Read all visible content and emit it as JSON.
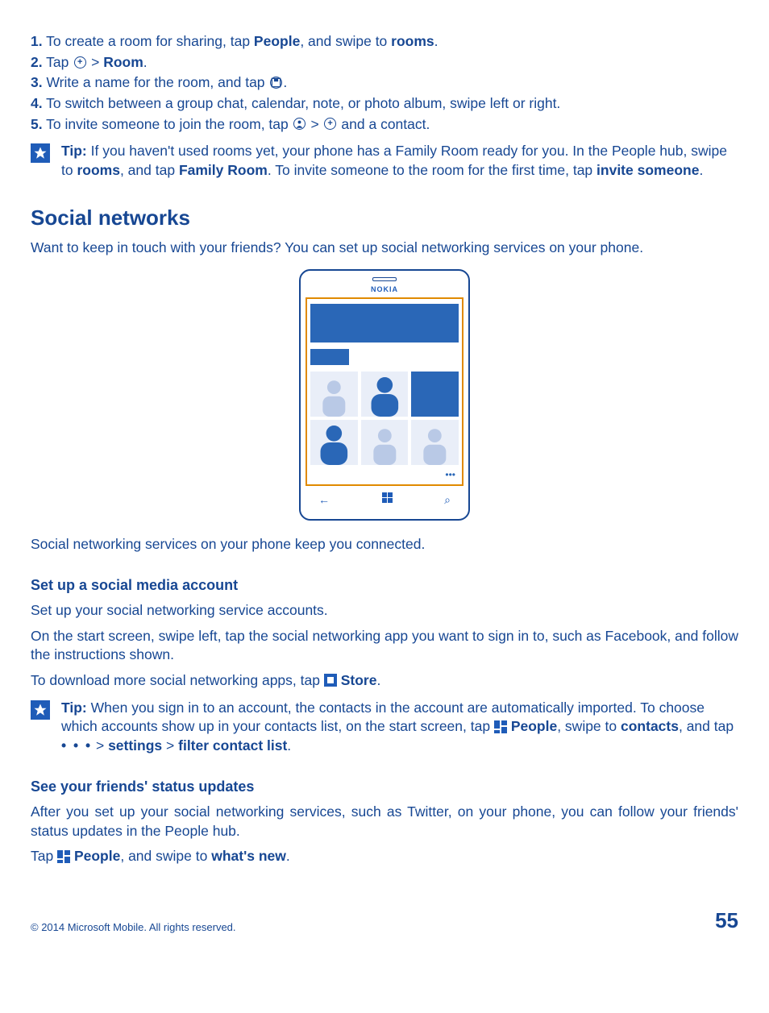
{
  "steps": [
    {
      "num": "1.",
      "pre": " To create a room for sharing, tap ",
      "b1": "People",
      "mid": ", and swipe to ",
      "b2": "rooms",
      "post": "."
    },
    {
      "num": "2.",
      "pre": " Tap ",
      "icon1": "plus",
      "mid": " > ",
      "b1": "Room",
      "post": "."
    },
    {
      "num": "3.",
      "pre": " Write a name for the room, and tap ",
      "icon1": "save",
      "post": "."
    },
    {
      "num": "4.",
      "pre": " To switch between a group chat, calendar, note, or photo album, swipe left or right."
    },
    {
      "num": "5.",
      "pre": " To invite someone to join the room, tap ",
      "icon1": "invite",
      "mid": " > ",
      "icon2": "plus",
      "post": " and a contact."
    }
  ],
  "tip1": {
    "label": "Tip:",
    "t1": " If you haven't used rooms yet, your phone has a Family Room ready for you. In the People hub, swipe to ",
    "b1": "rooms",
    "t2": ", and tap ",
    "b2": "Family Room",
    "t3": ". To invite someone to the room for the first time, tap ",
    "b3": "invite someone",
    "t4": "."
  },
  "section": "Social networks",
  "intro": "Want to keep in touch with your friends? You can set up social networking services on your phone.",
  "phone_brand": "NOKIA",
  "after_image": "Social networking services on your phone keep you connected.",
  "sub1": {
    "title": "Set up a social media account",
    "p1": "Set up your social networking service accounts.",
    "p2": "On the start screen, swipe left, tap the social networking app you want to sign in to, such as Facebook, and follow the instructions shown.",
    "p3a": "To download more social networking apps, tap ",
    "p3b": "Store",
    "p3c": "."
  },
  "tip2": {
    "label": "Tip:",
    "t1": " When you sign in to an account, the contacts in the account are automatically imported. To choose which accounts show up in your contacts list, on the start screen, tap ",
    "b1": "People",
    "t2": ", swipe to ",
    "b2": "contacts",
    "t3": ", and tap  ",
    "dots": "• • •",
    "t4": "  > ",
    "b3": "settings",
    "t5": " > ",
    "b4": "filter contact list",
    "t6": "."
  },
  "sub2": {
    "title": "See your friends' status updates",
    "p1": "After you set up your social networking services, such as Twitter, on your phone, you can follow your friends' status updates in the People hub.",
    "p2a": "Tap ",
    "p2b": "People",
    "p2c": ", and swipe to ",
    "p2d": "what's new",
    "p2e": "."
  },
  "footer": {
    "copyright": "© 2014 Microsoft Mobile. All rights reserved.",
    "page": "55"
  }
}
